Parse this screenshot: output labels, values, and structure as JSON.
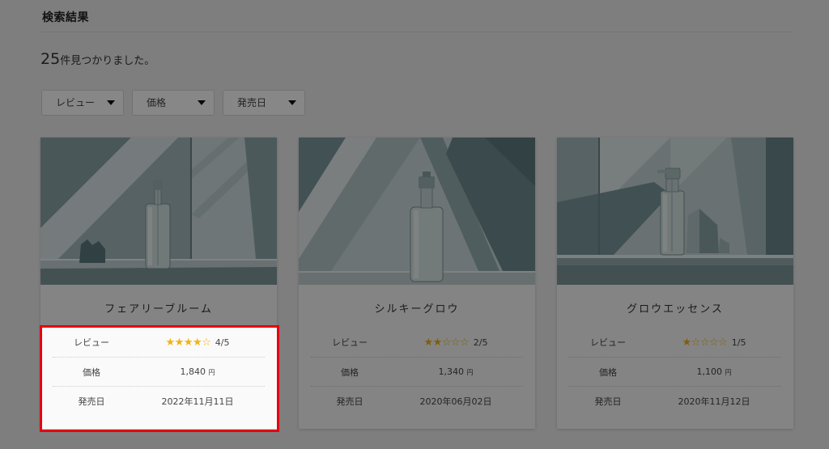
{
  "header": {
    "title": "検索結果"
  },
  "results": {
    "count": "25",
    "suffix": "件見つかりました。"
  },
  "filters": [
    {
      "label": "レビュー",
      "icon": "caret-down-icon"
    },
    {
      "label": "価格",
      "icon": "caret-down-icon"
    },
    {
      "label": "発売日",
      "icon": "caret-down-icon"
    }
  ],
  "spec_labels": {
    "review": "レビュー",
    "price": "価格",
    "release_date": "発売日"
  },
  "products": [
    {
      "name": "フェアリーブルーム",
      "rating": 4,
      "rating_max": 5,
      "rating_text": "4/5",
      "price": "1,840",
      "currency": "円",
      "release_date": "2022年11月11日"
    },
    {
      "name": "シルキーグロウ",
      "rating": 2,
      "rating_max": 5,
      "rating_text": "2/5",
      "price": "1,340",
      "currency": "円",
      "release_date": "2020年06月02日"
    },
    {
      "name": "グロウエッセンス",
      "rating": 1,
      "rating_max": 5,
      "rating_text": "1/5",
      "price": "1,100",
      "currency": "円",
      "release_date": "2020年11月12日"
    }
  ],
  "colors": {
    "highlight_border": "#e60012",
    "star": "#f2b40c"
  }
}
